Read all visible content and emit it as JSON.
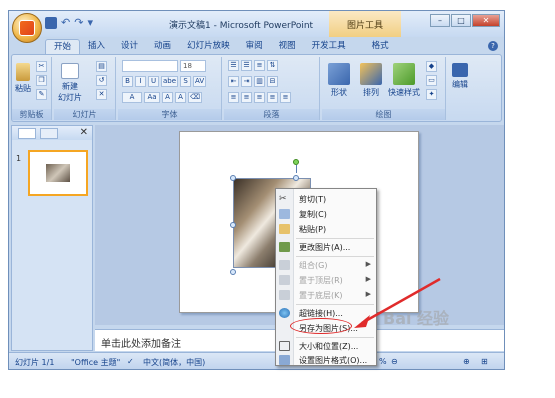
{
  "titlebar": {
    "title": "演示文稿1 - Microsoft PowerPoint",
    "context_tab_title": "图片工具"
  },
  "tabs": [
    {
      "label": "开始"
    },
    {
      "label": "插入"
    },
    {
      "label": "设计"
    },
    {
      "label": "动画"
    },
    {
      "label": "幻灯片放映"
    },
    {
      "label": "审阅"
    },
    {
      "label": "视图"
    },
    {
      "label": "开发工具"
    },
    {
      "label": "格式"
    }
  ],
  "ribbon": {
    "clipboard": {
      "paste": "粘贴",
      "group": "剪贴板"
    },
    "slides": {
      "new_slide_1": "新建",
      "new_slide_2": "幻灯片",
      "group": "幻灯片"
    },
    "font": {
      "size": "18",
      "group": "字体",
      "buttons": [
        "B",
        "I",
        "U",
        "abe",
        "S",
        "AV"
      ]
    },
    "paragraph": {
      "group": "段落"
    },
    "drawing": {
      "shape": "形状",
      "arrange": "排列",
      "quick_styles": "快速样式",
      "group": "绘图"
    },
    "editing": {
      "label": "编辑"
    }
  },
  "notes_placeholder": "单击此处添加备注",
  "status": {
    "slide": "幻灯片 1/1",
    "theme": "\"Office 主题\"",
    "language": "中文(简体，中国)",
    "zoom_fragment": "%"
  },
  "context_menu": {
    "items": [
      {
        "label": "剪切(T)",
        "disabled": false
      },
      {
        "label": "复制(C)",
        "disabled": false
      },
      {
        "label": "粘贴(P)",
        "disabled": false
      },
      {
        "label": "更改图片(A)...",
        "disabled": false
      },
      {
        "label": "组合(G)",
        "disabled": true
      },
      {
        "label": "置于顶层(R)",
        "disabled": true
      },
      {
        "label": "置于底层(K)",
        "disabled": true
      },
      {
        "label": "超链接(H)...",
        "disabled": false
      },
      {
        "label": "另存为图片(S)...",
        "disabled": false
      },
      {
        "label": "大小和位置(Z)...",
        "disabled": false
      },
      {
        "label": "设置图片格式(O)...",
        "disabled": false
      }
    ]
  },
  "watermark": "Bai 经验",
  "colors": {
    "highlight": "#e02b2b",
    "ribbon": "#dfe9f5",
    "menu_bg": "#fafafa"
  }
}
